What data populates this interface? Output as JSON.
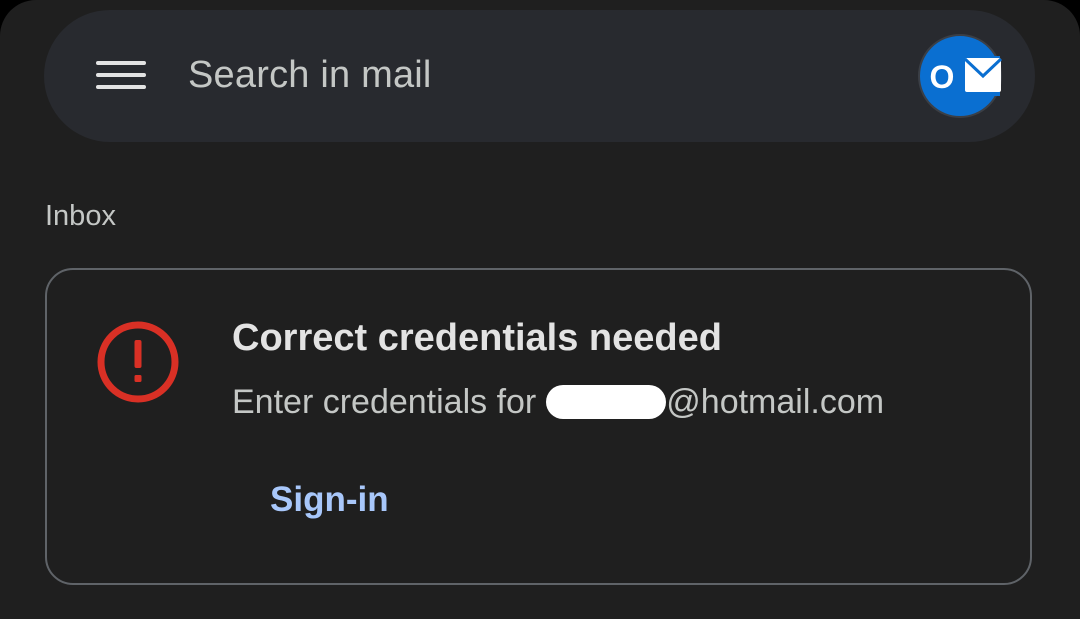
{
  "search": {
    "placeholder": "Search in mail"
  },
  "account": {
    "badge_letter": "O",
    "icon": "outlook-account-icon",
    "colors": {
      "avatar_bg": "#0a6fd1",
      "envelope": "#ffffff"
    }
  },
  "folder": {
    "label": "Inbox"
  },
  "alert_card": {
    "title": "Correct credentials needed",
    "body_prefix": "Enter credentials for",
    "email_suffix": "@hotmail.com",
    "action_label": "Sign-in",
    "icon": "error-alert-icon",
    "colors": {
      "error": "#d93025",
      "action": "#a8c7fa"
    }
  },
  "icons": {
    "menu": "hamburger-menu-icon"
  }
}
